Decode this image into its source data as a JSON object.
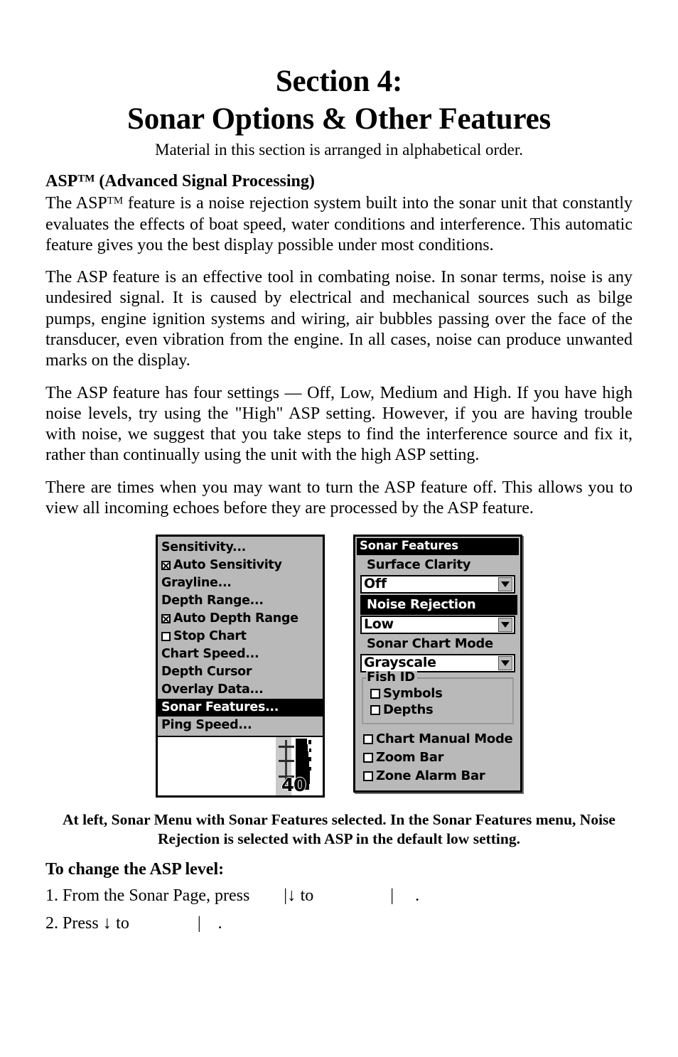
{
  "page": {
    "section_number_title": "Section 4:",
    "section_title": "Sonar Options & Other Features",
    "subtitle": "Material in this section is arranged in alphabetical order."
  },
  "topic": {
    "heading_main": "ASP",
    "heading_tm": "TM",
    "heading_rest": " (Advanced Signal Processing)",
    "paragraphs": [
      {
        "pre": "The ASP",
        "tm": "TM",
        "post": " feature is a noise rejection system built into the sonar unit that constantly evaluates the effects of boat speed, water conditions and interference. This automatic feature gives you the best display pos­sible under most conditions."
      },
      {
        "text": "The ASP feature is an effective tool in combating noise. In sonar terms, noise is any undesired signal. It is caused by electrical and mechanical sources such as bilge pumps, engine ignition systems and wiring, air bubbles passing over the face of the transducer, even vibration from the engine. In all cases, noise can produce unwanted marks on the display."
      },
      {
        "text": "The ASP feature has four settings — Off, Low, Medium and High. If you have high noise levels, try using the \"High\" ASP setting. However, if you are having trouble with noise, we suggest that you take steps to find the interference source and fix it, rather than continually using the unit with the high ASP setting."
      },
      {
        "text": "There are times when you may want to turn the ASP feature off. This allows you to view all incoming echoes before they are processed by the ASP feature."
      }
    ]
  },
  "figure": {
    "sonar_menu": {
      "items": [
        {
          "label": "Sensitivity...",
          "checkbox": "none",
          "selected": false
        },
        {
          "label": "Auto Sensitivity",
          "checkbox": "checked",
          "selected": false
        },
        {
          "label": "Grayline...",
          "checkbox": "none",
          "selected": false
        },
        {
          "label": "Depth Range...",
          "checkbox": "none",
          "selected": false
        },
        {
          "label": "Auto Depth Range",
          "checkbox": "checked",
          "selected": false
        },
        {
          "label": "Stop Chart",
          "checkbox": "unchecked",
          "selected": false
        },
        {
          "label": "Chart Speed...",
          "checkbox": "none",
          "selected": false
        },
        {
          "label": "Depth Cursor",
          "checkbox": "none",
          "selected": false
        },
        {
          "label": "Overlay Data...",
          "checkbox": "none",
          "selected": false
        },
        {
          "label": "Sonar Features...",
          "checkbox": "none",
          "selected": true
        },
        {
          "label": "Ping Speed...",
          "checkbox": "none",
          "selected": false
        }
      ],
      "chart_depth_reading": "40"
    },
    "sonar_features": {
      "title": "Sonar Features",
      "fields": [
        {
          "label": "Surface Clarity",
          "value": "Off",
          "selected": false
        },
        {
          "label": "Noise Rejection",
          "value": "Low",
          "selected": true
        },
        {
          "label": "Sonar Chart Mode",
          "value": "Grayscale",
          "selected": false
        }
      ],
      "fish_id": {
        "group_label": "Fish ID",
        "options": [
          {
            "label": "Symbols",
            "checked": false
          },
          {
            "label": "Depths",
            "checked": false
          }
        ]
      },
      "extra_options": [
        {
          "label": "Chart Manual Mode",
          "checked": false
        },
        {
          "label": "Zoom Bar",
          "checked": false
        },
        {
          "label": "Zone Alarm Bar",
          "checked": false
        }
      ]
    },
    "caption_line1": "At left, Sonar Menu with Sonar Features selected. In the Sonar Features",
    "caption_line2": "menu, Noise Rejection is selected with ASP in the default low setting."
  },
  "instructions": {
    "heading": "To change the ASP level:",
    "steps": [
      {
        "lead": "1. From the Sonar Page, press",
        "gap1": "        ",
        "bar1": "|",
        "arrow": "↓",
        "mid": " to",
        "gap2": "                  ",
        "bar2": "|",
        "gap3": "     ",
        "end": "."
      },
      {
        "lead": "2. Press",
        "gap1": " ",
        "arrow": "↓",
        "mid": " to",
        "gap2": "                ",
        "bar2": "|",
        "gap3": "    ",
        "end": "."
      }
    ]
  }
}
